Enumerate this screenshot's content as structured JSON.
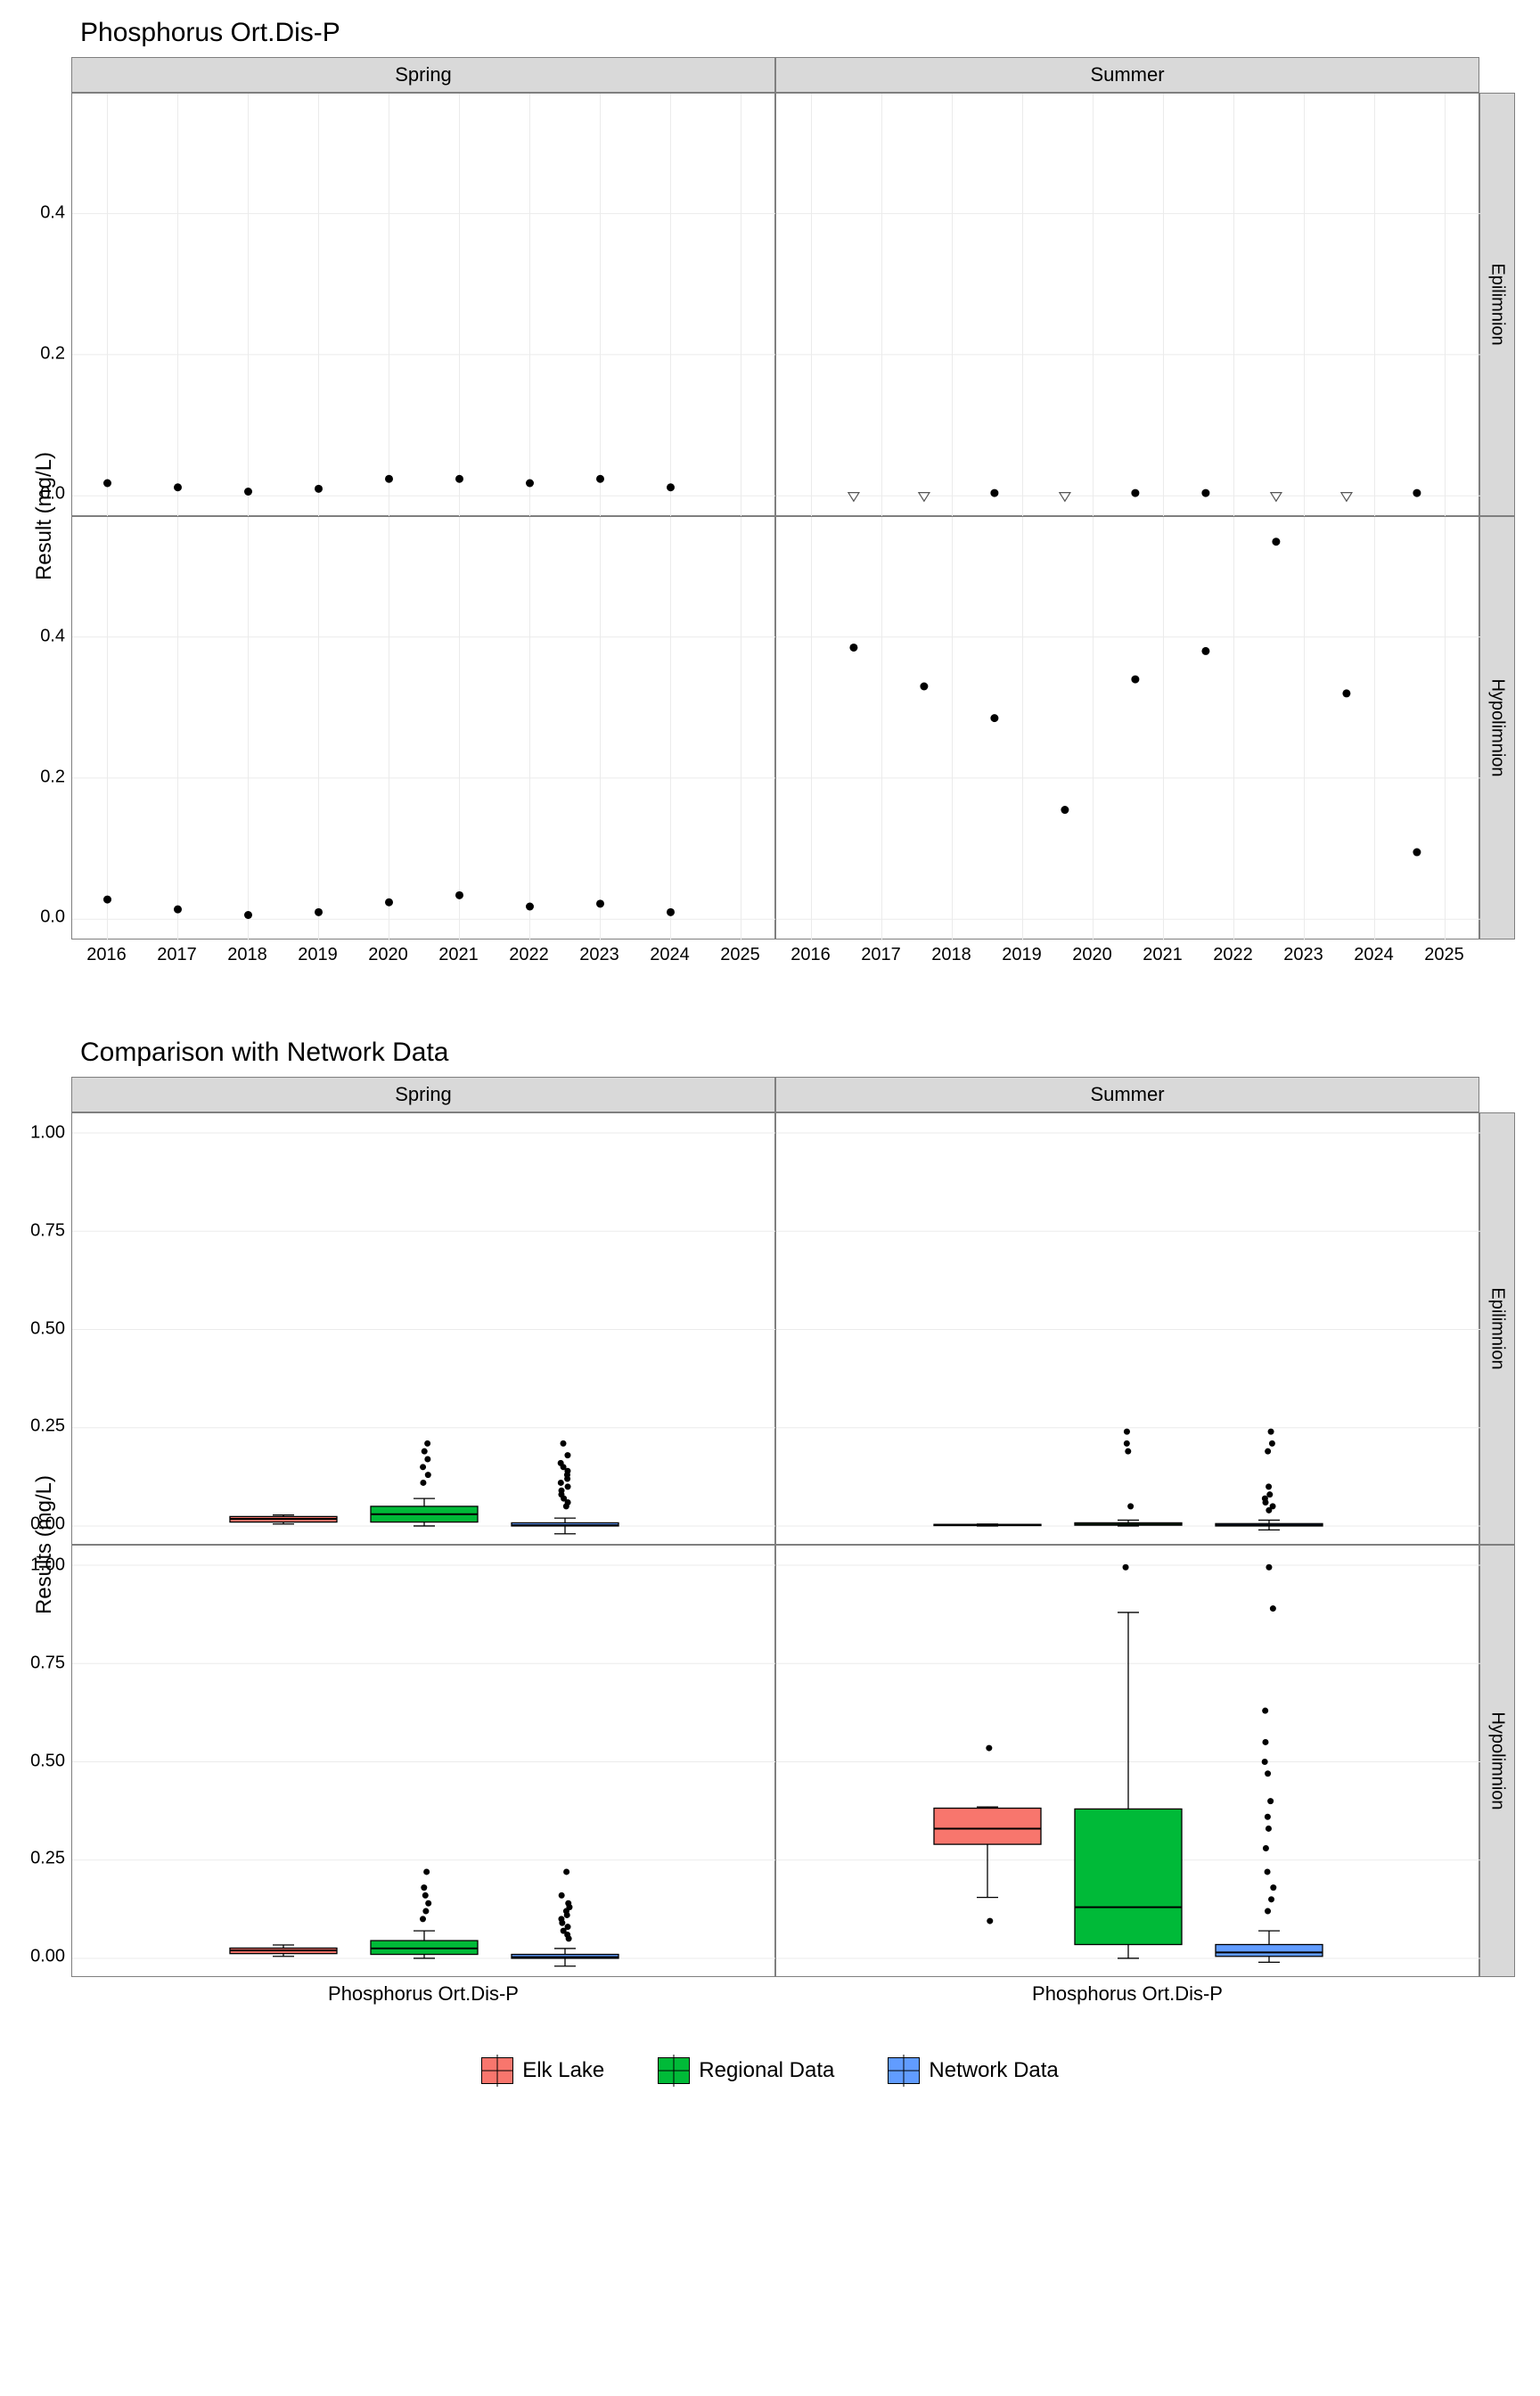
{
  "chart_data": [
    {
      "id": "scatter",
      "type": "scatter",
      "title": "Phosphorus Ort.Dis-P",
      "ylabel": "Result (mg/L)",
      "x_ticks": [
        2016,
        2017,
        2018,
        2019,
        2020,
        2021,
        2022,
        2023,
        2024,
        2025
      ],
      "y_ticks": [
        0.0,
        0.2,
        0.4
      ],
      "ylim": [
        -0.03,
        0.57
      ],
      "col_facets": [
        "Spring",
        "Summer"
      ],
      "row_facets": [
        "Epilimnion",
        "Hypolimnion"
      ],
      "panels": [
        {
          "row": "Epilimnion",
          "col": "Spring",
          "points": [
            {
              "x": 2016,
              "y": 0.018
            },
            {
              "x": 2017,
              "y": 0.012
            },
            {
              "x": 2018,
              "y": 0.006
            },
            {
              "x": 2019,
              "y": 0.01
            },
            {
              "x": 2020,
              "y": 0.024
            },
            {
              "x": 2021,
              "y": 0.024
            },
            {
              "x": 2022,
              "y": 0.018
            },
            {
              "x": 2023,
              "y": 0.024
            },
            {
              "x": 2024,
              "y": 0.012
            }
          ],
          "triangles": []
        },
        {
          "row": "Epilimnion",
          "col": "Summer",
          "points": [
            {
              "x": 2018.6,
              "y": 0.004
            },
            {
              "x": 2020.6,
              "y": 0.004
            },
            {
              "x": 2021.6,
              "y": 0.004
            },
            {
              "x": 2024.6,
              "y": 0.004
            }
          ],
          "triangles": [
            {
              "x": 2016.6,
              "y": 0.0
            },
            {
              "x": 2017.6,
              "y": 0.0
            },
            {
              "x": 2019.6,
              "y": 0.0
            },
            {
              "x": 2022.6,
              "y": 0.0
            },
            {
              "x": 2023.6,
              "y": 0.0
            }
          ]
        },
        {
          "row": "Hypolimnion",
          "col": "Spring",
          "points": [
            {
              "x": 2016,
              "y": 0.028
            },
            {
              "x": 2017,
              "y": 0.014
            },
            {
              "x": 2018,
              "y": 0.006
            },
            {
              "x": 2019,
              "y": 0.01
            },
            {
              "x": 2020,
              "y": 0.024
            },
            {
              "x": 2021,
              "y": 0.034
            },
            {
              "x": 2022,
              "y": 0.018
            },
            {
              "x": 2023,
              "y": 0.022
            },
            {
              "x": 2024,
              "y": 0.01
            }
          ],
          "triangles": []
        },
        {
          "row": "Hypolimnion",
          "col": "Summer",
          "points": [
            {
              "x": 2016.6,
              "y": 0.385
            },
            {
              "x": 2017.6,
              "y": 0.33
            },
            {
              "x": 2018.6,
              "y": 0.285
            },
            {
              "x": 2019.6,
              "y": 0.155
            },
            {
              "x": 2020.6,
              "y": 0.34
            },
            {
              "x": 2021.6,
              "y": 0.38
            },
            {
              "x": 2022.6,
              "y": 0.535
            },
            {
              "x": 2023.6,
              "y": 0.32
            },
            {
              "x": 2024.6,
              "y": 0.095
            }
          ],
          "triangles": []
        }
      ]
    },
    {
      "id": "box",
      "type": "boxplot",
      "title": "Comparison with Network Data",
      "ylabel": "Results (mg/L)",
      "x_category": "Phosphorus Ort.Dis-P",
      "y_ticks": [
        0.0,
        0.25,
        0.5,
        0.75,
        1.0
      ],
      "ylim": [
        -0.05,
        1.05
      ],
      "col_facets": [
        "Spring",
        "Summer"
      ],
      "row_facets": [
        "Epilimnion",
        "Hypolimnion"
      ],
      "groups": [
        {
          "name": "Elk Lake",
          "color": "#f8766d"
        },
        {
          "name": "Regional Data",
          "color": "#00ba38"
        },
        {
          "name": "Network Data",
          "color": "#619cff"
        }
      ],
      "panels": [
        {
          "row": "Epilimnion",
          "col": "Spring",
          "boxes": [
            {
              "g": 0,
              "min": 0.005,
              "q1": 0.01,
              "med": 0.018,
              "q3": 0.024,
              "max": 0.028,
              "out": []
            },
            {
              "g": 1,
              "min": 0.0,
              "q1": 0.01,
              "med": 0.03,
              "q3": 0.05,
              "max": 0.07,
              "out": [
                0.11,
                0.13,
                0.15,
                0.17,
                0.19,
                0.21
              ]
            },
            {
              "g": 2,
              "min": -0.02,
              "q1": 0.0,
              "med": 0.002,
              "q3": 0.008,
              "max": 0.02,
              "out": [
                0.05,
                0.06,
                0.07,
                0.08,
                0.09,
                0.1,
                0.11,
                0.12,
                0.13,
                0.14,
                0.15,
                0.16,
                0.18,
                0.21
              ]
            }
          ]
        },
        {
          "row": "Epilimnion",
          "col": "Summer",
          "boxes": [
            {
              "g": 0,
              "min": 0.0,
              "q1": 0.001,
              "med": 0.003,
              "q3": 0.004,
              "max": 0.005,
              "out": []
            },
            {
              "g": 1,
              "min": 0.0,
              "q1": 0.002,
              "med": 0.004,
              "q3": 0.008,
              "max": 0.015,
              "out": [
                0.05,
                0.19,
                0.21,
                0.24
              ]
            },
            {
              "g": 2,
              "min": -0.01,
              "q1": 0.0,
              "med": 0.002,
              "q3": 0.006,
              "max": 0.015,
              "out": [
                0.04,
                0.05,
                0.06,
                0.07,
                0.08,
                0.1,
                0.19,
                0.21,
                0.24
              ]
            }
          ]
        },
        {
          "row": "Hypolimnion",
          "col": "Spring",
          "boxes": [
            {
              "g": 0,
              "min": 0.005,
              "q1": 0.012,
              "med": 0.02,
              "q3": 0.026,
              "max": 0.034,
              "out": []
            },
            {
              "g": 1,
              "min": 0.0,
              "q1": 0.01,
              "med": 0.025,
              "q3": 0.045,
              "max": 0.07,
              "out": [
                0.1,
                0.12,
                0.14,
                0.16,
                0.18,
                0.22
              ]
            },
            {
              "g": 2,
              "min": -0.02,
              "q1": 0.0,
              "med": 0.003,
              "q3": 0.01,
              "max": 0.025,
              "out": [
                0.05,
                0.06,
                0.07,
                0.08,
                0.09,
                0.1,
                0.11,
                0.12,
                0.13,
                0.14,
                0.16,
                0.22
              ]
            }
          ]
        },
        {
          "row": "Hypolimnion",
          "col": "Summer",
          "boxes": [
            {
              "g": 0,
              "min": 0.155,
              "q1": 0.29,
              "med": 0.33,
              "q3": 0.382,
              "max": 0.385,
              "out": [
                0.095,
                0.535
              ]
            },
            {
              "g": 1,
              "min": 0.0,
              "q1": 0.035,
              "med": 0.13,
              "q3": 0.38,
              "max": 0.88,
              "out": [
                0.995
              ]
            },
            {
              "g": 2,
              "min": -0.01,
              "q1": 0.005,
              "med": 0.015,
              "q3": 0.035,
              "max": 0.07,
              "out": [
                0.12,
                0.15,
                0.18,
                0.22,
                0.28,
                0.33,
                0.36,
                0.4,
                0.47,
                0.5,
                0.55,
                0.63,
                0.89,
                0.995
              ]
            }
          ]
        }
      ]
    }
  ],
  "legend": [
    "Elk Lake",
    "Regional Data",
    "Network Data"
  ]
}
